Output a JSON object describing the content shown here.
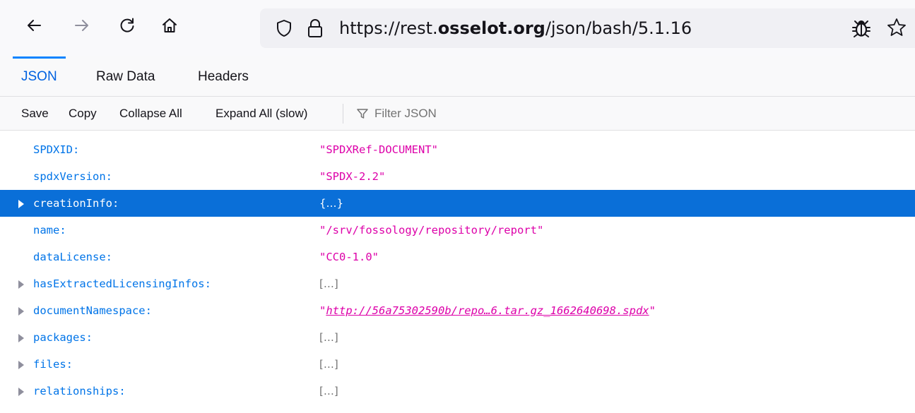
{
  "browser": {
    "url_prefix": "https://rest.",
    "url_host": "osselot.org",
    "url_path": "/json/bash/5.1.16",
    "icons": [
      "back-arrow-icon",
      "forward-arrow-icon",
      "reload-icon",
      "home-icon",
      "shield-icon",
      "lock-icon",
      "bug-icon",
      "star-icon"
    ]
  },
  "tabs": [
    {
      "label": "JSON",
      "active": true
    },
    {
      "label": "Raw Data",
      "active": false
    },
    {
      "label": "Headers",
      "active": false
    }
  ],
  "actions": {
    "save": "Save",
    "copy": "Copy",
    "collapse_all": "Collapse All",
    "expand_all": "Expand All (slow)",
    "filter_placeholder": "Filter JSON"
  },
  "rows": [
    {
      "key": "SPDXID:",
      "value": "\"SPDXRef-DOCUMENT\"",
      "type": "string",
      "expandable": false,
      "selected": false
    },
    {
      "key": "spdxVersion:",
      "value": "\"SPDX-2.2\"",
      "type": "string",
      "expandable": false,
      "selected": false
    },
    {
      "key": "creationInfo:",
      "value": "{…}",
      "type": "object",
      "expandable": true,
      "selected": true
    },
    {
      "key": "name:",
      "value": "\"/srv/fossology/repository/report\"",
      "type": "string",
      "expandable": false,
      "selected": false
    },
    {
      "key": "dataLicense:",
      "value": "\"CC0-1.0\"",
      "type": "string",
      "expandable": false,
      "selected": false
    },
    {
      "key": "hasExtractedLicensingInfos:",
      "value": "[…]",
      "type": "array",
      "expandable": true,
      "selected": false
    },
    {
      "key": "documentNamespace:",
      "value": "http://56a75302590b/repo…6.tar.gz_1662640698.spdx",
      "type": "link",
      "expandable": true,
      "selected": false
    },
    {
      "key": "packages:",
      "value": "[…]",
      "type": "array",
      "expandable": true,
      "selected": false
    },
    {
      "key": "files:",
      "value": "[…]",
      "type": "array",
      "expandable": true,
      "selected": false
    },
    {
      "key": "relationships:",
      "value": "[…]",
      "type": "array",
      "expandable": true,
      "selected": false
    }
  ],
  "colors": {
    "key": "#0074e8",
    "string": "#dd00a9",
    "selected_bg": "#0a6fd8",
    "active_tab": "#0061e0"
  }
}
